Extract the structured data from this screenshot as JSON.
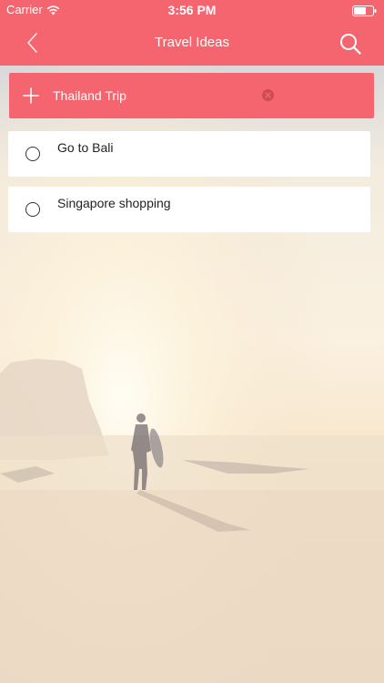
{
  "status_bar": {
    "carrier": "Carrier",
    "time": "3:56 PM",
    "wifi_icon": "wifi-icon",
    "battery_icon": "battery-icon"
  },
  "nav": {
    "title": "Travel Ideas",
    "back_icon": "chevron-left-icon",
    "search_icon": "search-icon",
    "bar_color": "#f5656f"
  },
  "add_row": {
    "value": "Thailand Trip",
    "add_icon": "plus-icon",
    "clear_icon": "clear-circle-icon"
  },
  "todos": [
    {
      "label": "Go to Bali",
      "checked": false
    },
    {
      "label": "Singapore shopping",
      "checked": false
    }
  ],
  "colors": {
    "accent": "#f5656f",
    "card": "#ffffff",
    "text": "#222222"
  }
}
